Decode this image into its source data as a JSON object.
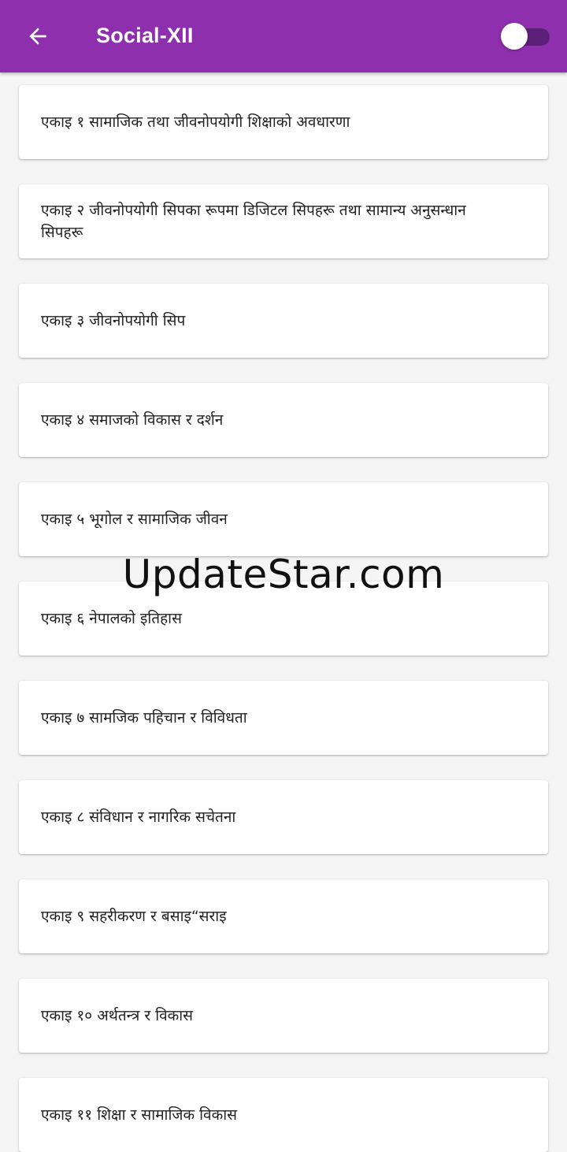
{
  "app_bar": {
    "title": "Social-XII",
    "back_icon": "arrow-left-icon",
    "background_color": "#8e2fae",
    "toggle": {
      "state": "off",
      "track_color": "#5c1f78",
      "thumb_color": "#ffffff"
    }
  },
  "units": [
    {
      "label": "एकाइ १ सामाजिक तथा जीवनोपयोगी शिक्षाको अवधारणा"
    },
    {
      "label": "एकाइ २ जीवनोपयोगी सिपका रूपमा डिजिटल सिपहरू तथा सामान्य अनुसन्धान सिपहरू"
    },
    {
      "label": "एकाइ ३ जीवनोपयोगी सिप"
    },
    {
      "label": "एकाइ ४ समाजको विकास र दर्शन"
    },
    {
      "label": "एकाइ ५ भूगोल र सामाजिक जीवन"
    },
    {
      "label": "एकाइ ६ नेपालको इतिहास"
    },
    {
      "label": "एकाइ ७ सामजिक पहिचान र विविधता"
    },
    {
      "label": "एकाइ ८ संविधान र नागरिक सचेतना"
    },
    {
      "label": "एकाइ ९ सहरीकरण र बसाइ“सराइ"
    },
    {
      "label": "एकाइ १० अर्थतन्त्र र विकास"
    },
    {
      "label": "एकाइ ११ शिक्षा र सामाजिक विकास"
    }
  ],
  "watermark": {
    "text": "UpdateStar.com"
  }
}
